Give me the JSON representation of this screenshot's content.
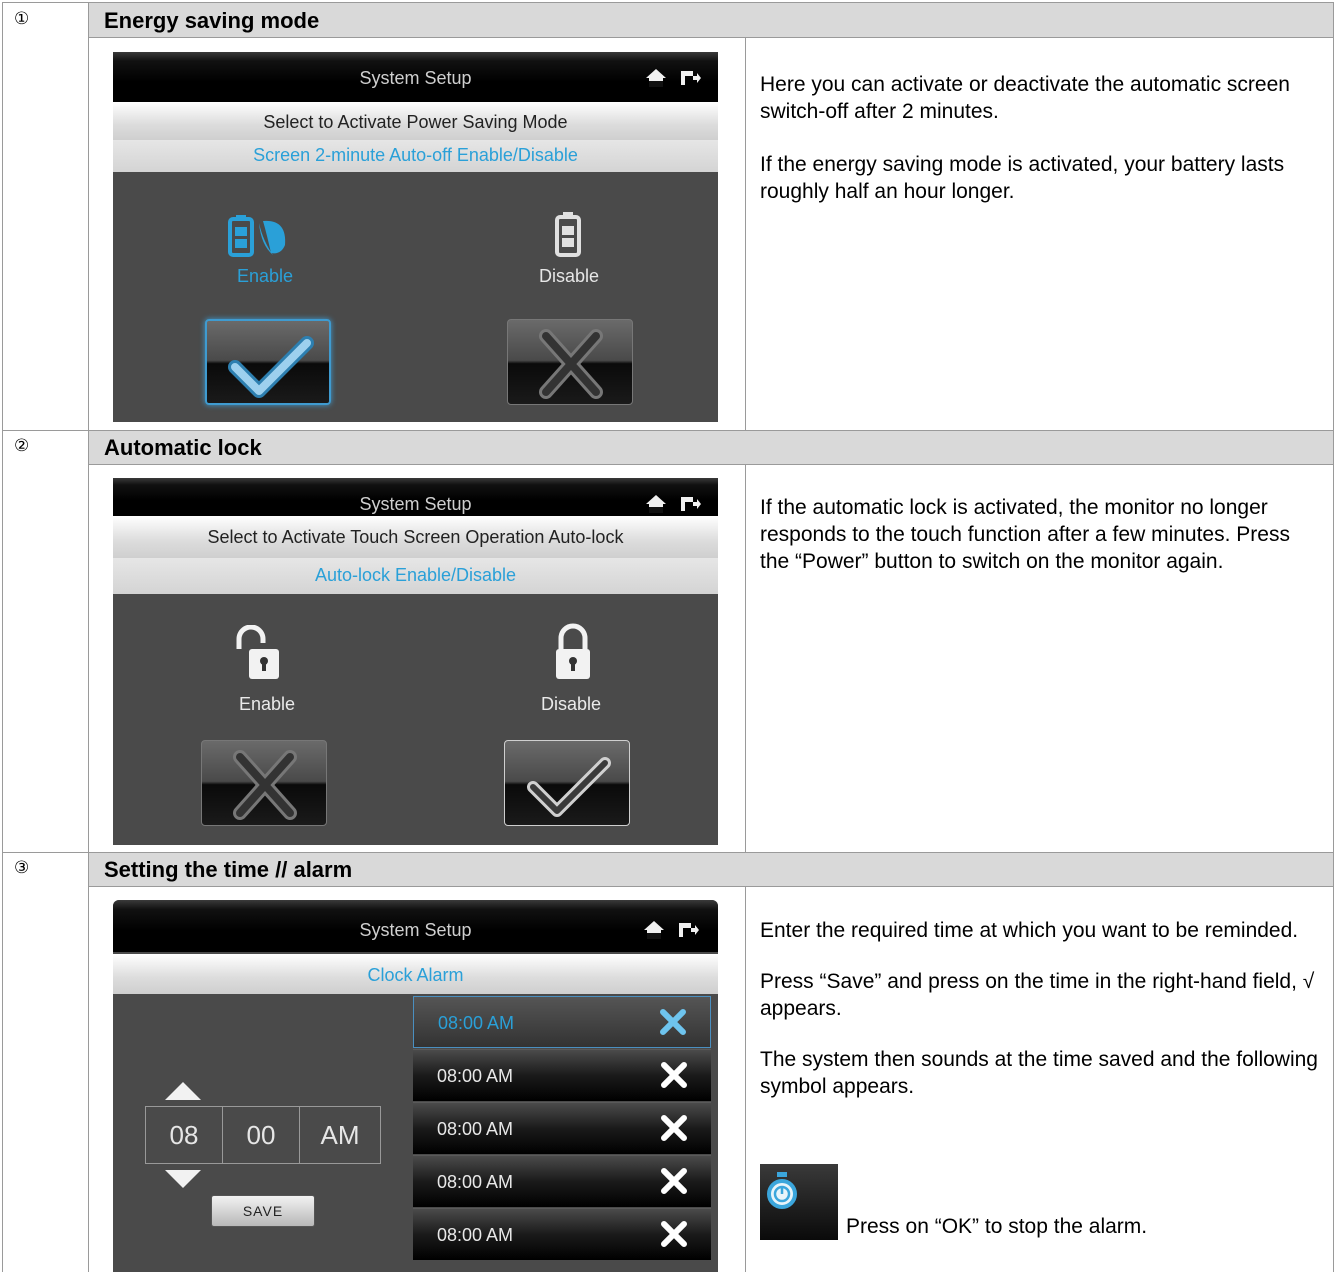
{
  "sections": [
    {
      "number": "①",
      "title": "Energy saving mode",
      "screen": {
        "header": "System Setup",
        "subtitle": "Select to Activate Power Saving Mode",
        "subtitle_blue": "Screen 2-minute Auto-off Enable/Disable",
        "option_left": "Enable",
        "option_right": "Disable"
      },
      "description": [
        "Here you can activate or deactivate the automatic screen switch-off after 2 minutes.",
        "If the energy saving mode is activated, your battery lasts roughly half an hour longer."
      ]
    },
    {
      "number": "②",
      "title": "Automatic lock",
      "screen": {
        "header": "System Setup",
        "subtitle": "Select to Activate Touch Screen Operation Auto-lock",
        "subtitle_blue": "Auto-lock Enable/Disable",
        "option_left": "Enable",
        "option_right": "Disable"
      },
      "description": [
        "If the automatic lock is activated, the monitor no longer responds to the touch function after a few minutes. Press the “Power” button to switch on the monitor again."
      ]
    },
    {
      "number": "③",
      "title": "Setting the time // alarm",
      "screen": {
        "header": "System Setup",
        "subtitle_blue": "Clock Alarm",
        "hour": "08",
        "minute": "00",
        "ampm": "AM",
        "save_label": "SAVE",
        "alarms": [
          "08:00 AM",
          "08:00 AM",
          "08:00 AM",
          "08:00 AM",
          "08:00 AM"
        ]
      },
      "description": [
        "Enter the required time at which you want to be reminded.",
        "Press “Save” and press on the time in the right-hand field, √ appears.",
        "The system then sounds at the time saved and the following symbol appears."
      ],
      "after_icon": "Press on “OK” to stop the alarm."
    }
  ],
  "colors": {
    "accent_blue": "#2aa0d8",
    "header_gray": "#d9d9d9",
    "screen_bg": "#4a4a4a"
  }
}
